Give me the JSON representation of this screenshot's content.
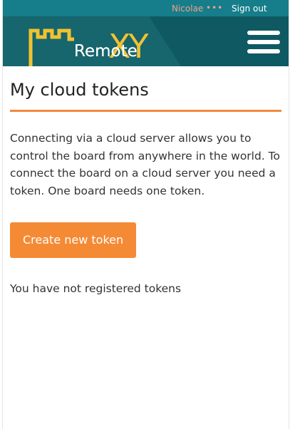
{
  "topbar": {
    "user_name": "Nicolae",
    "dots": "•••",
    "signout_label": "Sign out"
  },
  "header": {
    "logo_text": "Remote",
    "logo_xy": "XY",
    "menu_icon": "hamburger-menu-icon"
  },
  "page": {
    "title": "My cloud tokens",
    "intro": "Connecting via a cloud server allows you to control the board from anywhere in the world. To connect the board on a cloud server you need a token. One board needs one token.",
    "create_button_label": "Create new token",
    "empty_message": "You have not registered tokens"
  },
  "colors": {
    "topbar": "#157e8a",
    "header": "#0f5962",
    "accent": "#f58a35",
    "logo_yellow": "#f2c230",
    "user_name": "#f0a08c"
  }
}
